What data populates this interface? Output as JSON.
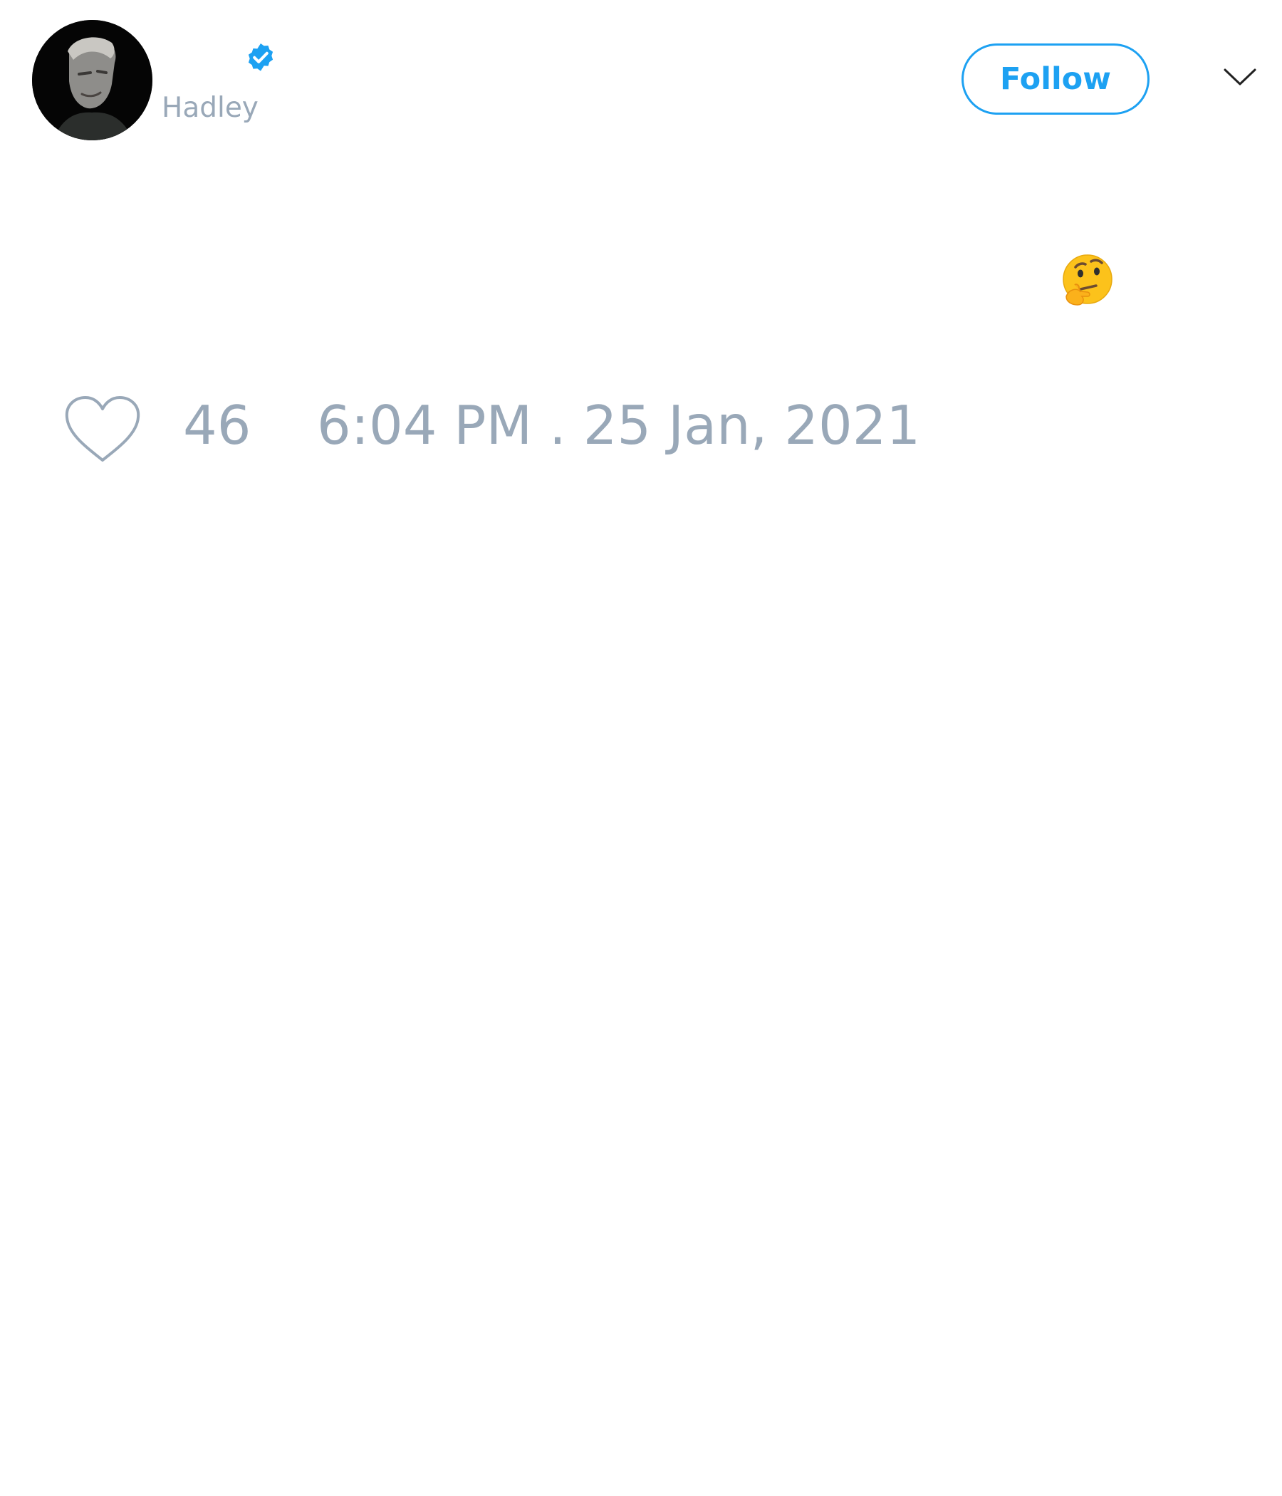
{
  "author": {
    "handle": "Hadley",
    "verified": true,
    "avatar_description": "profile-photo"
  },
  "header": {
    "follow_label": "Follow",
    "menu_icon": "chevron-down-icon"
  },
  "tweet": {
    "emoji": "🤔",
    "like_icon": "heart-icon",
    "like_count": "46",
    "timestamp": "6:04 PM . 25 Jan, 2021"
  },
  "colors": {
    "accent": "#1da1f2",
    "muted_text": "#99a8b8",
    "background": "#ffffff"
  }
}
